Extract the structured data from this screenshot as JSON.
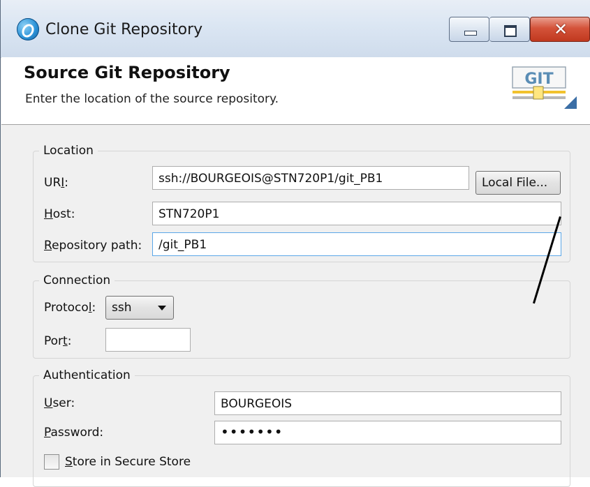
{
  "window": {
    "title": "Clone Git Repository",
    "close_glyph": "✕",
    "min_icon": "minimize-icon",
    "max_icon": "maximize-icon",
    "app_icon": "eclipse-icon"
  },
  "header": {
    "title": "Source Git Repository",
    "subtitle": "Enter the location of the source repository.",
    "badge_text": "GIT"
  },
  "location": {
    "legend": "Location",
    "uri_label_pre": "UR",
    "uri_label_mn": "I",
    "uri_label_post": ":",
    "uri_value": "ssh://BOURGEOIS@STN720P1/git_PB1",
    "local_file_button": "Local File...",
    "host_label_mn": "H",
    "host_label_post": "ost:",
    "host_value": "STN720P1",
    "repo_label_mn": "R",
    "repo_label_post": "epository path:",
    "repo_value": "/git_PB1"
  },
  "connection": {
    "legend": "Connection",
    "protocol_label_pre": "Protoco",
    "protocol_label_mn": "l",
    "protocol_label_post": ":",
    "protocol_value": "ssh",
    "port_label_pre": "Por",
    "port_label_mn": "t",
    "port_label_post": ":",
    "port_value": ""
  },
  "authentication": {
    "legend": "Authentication",
    "user_label_mn": "U",
    "user_label_post": "ser:",
    "user_value": "BOURGEOIS",
    "password_label_mn": "P",
    "password_label_post": "assword:",
    "password_value": "•••••••",
    "store_label_mn": "S",
    "store_label_post": "tore in Secure Store",
    "store_checked": false
  }
}
